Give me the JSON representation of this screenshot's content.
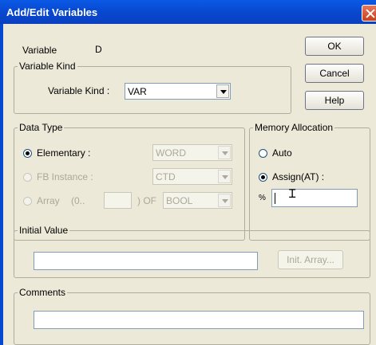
{
  "window": {
    "title": "Add/Edit Variables"
  },
  "variable": {
    "label": "Variable",
    "value": "D"
  },
  "buttons": {
    "ok": "OK",
    "cancel": "Cancel",
    "help": "Help",
    "init_array": "Init. Array..."
  },
  "variable_kind": {
    "group_title": "Variable Kind",
    "label": "Variable Kind :",
    "value": "VAR"
  },
  "data_type": {
    "group_title": "Data Type",
    "elementary": {
      "label": "Elementary :",
      "value": "WORD",
      "selected": true
    },
    "fb_instance": {
      "label": "FB Instance :",
      "value": "CTD",
      "selected": false
    },
    "array": {
      "label": "Array",
      "range_prefix": "(0..",
      "range_suffix": ") OF",
      "type": "BOOL",
      "selected": false
    }
  },
  "memory_allocation": {
    "group_title": "Memory Allocation",
    "auto_label": "Auto",
    "assign_label": "Assign(AT) :",
    "selected": "assign",
    "address_prefix": "%",
    "address_value": ""
  },
  "initial_value": {
    "group_title": "Initial Value",
    "value": ""
  },
  "comments": {
    "group_title": "Comments",
    "value": ""
  },
  "colors": {
    "titlebar": "#0848d0",
    "dialog_bg": "#ece9d8",
    "disabled_text": "#aca899"
  }
}
